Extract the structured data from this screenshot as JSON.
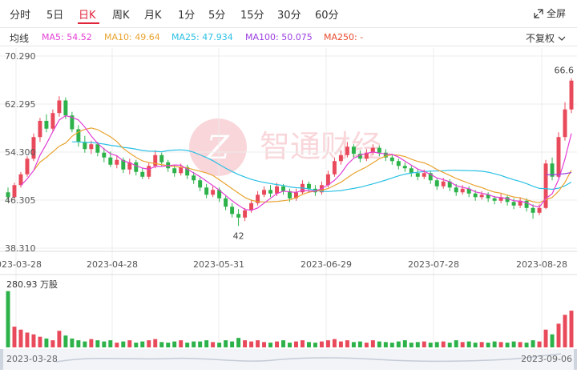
{
  "tabs": [
    {
      "label": "分时"
    },
    {
      "label": "5日"
    },
    {
      "label": "日K"
    },
    {
      "label": "周K"
    },
    {
      "label": "月K"
    },
    {
      "label": "1分"
    },
    {
      "label": "5分"
    },
    {
      "label": "15分"
    },
    {
      "label": "30分"
    },
    {
      "label": "60分"
    }
  ],
  "active_tab": "日K",
  "fullscreen_label": "全屏",
  "ma_legend": {
    "title": "均线",
    "ma5": "MA5: 54.52",
    "ma10": "MA10: 49.64",
    "ma25": "MA25: 47.934",
    "ma100": "MA100: 50.075",
    "ma250": "MA250: -"
  },
  "adjust_label": "不复权",
  "watermark_text": "智通财经",
  "volume_label": "280.93 万股",
  "navigator": {
    "start": "2023-03-28",
    "end": "2023-09-06"
  },
  "colors": {
    "up": "#e94a5b",
    "down": "#2db24a",
    "accent": "#e0243a",
    "ma5": "#e33fd5",
    "ma10": "#e9a330",
    "ma25": "#2bc0e4",
    "ma100": "#9b3fe0",
    "ma250": "#e84b2e"
  },
  "chart_data": {
    "type": "candlestick",
    "y_ticks": [
      "70.290",
      "62.295",
      "54.300",
      "46.305",
      "38.310"
    ],
    "ylim": [
      38.31,
      70.29
    ],
    "x_ticks": [
      "2023-03-28",
      "2023-04-28",
      "2023-05-31",
      "2023-06-29",
      "2023-07-28",
      "2023-08-28"
    ],
    "annotations": {
      "low": "42",
      "high": "66.6"
    },
    "candles": [
      [
        47.6,
        46.8,
        48.4,
        46.0
      ],
      [
        46.8,
        48.8,
        49.2,
        46.5
      ],
      [
        48.8,
        50.6,
        51.0,
        48.4
      ],
      [
        50.6,
        53.2,
        53.6,
        50.2
      ],
      [
        53.2,
        56.8,
        57.4,
        52.8
      ],
      [
        56.8,
        59.5,
        60.0,
        56.0
      ],
      [
        59.5,
        58.2,
        60.6,
        57.6
      ],
      [
        58.2,
        60.8,
        61.4,
        57.8
      ],
      [
        60.8,
        62.9,
        63.6,
        60.2
      ],
      [
        62.9,
        60.4,
        63.4,
        59.8
      ],
      [
        60.4,
        58.1,
        61.0,
        57.6
      ],
      [
        58.1,
        56.0,
        58.8,
        55.2
      ],
      [
        56.0,
        54.8,
        57.0,
        54.2
      ],
      [
        54.8,
        55.6,
        56.2,
        54.0
      ],
      [
        55.6,
        54.2,
        56.0,
        53.6
      ],
      [
        54.2,
        53.4,
        55.0,
        52.6
      ],
      [
        53.4,
        52.2,
        54.4,
        51.8
      ],
      [
        52.2,
        53.0,
        53.8,
        51.6
      ],
      [
        53.0,
        51.4,
        53.4,
        50.8
      ],
      [
        51.4,
        52.6,
        53.2,
        50.6
      ],
      [
        52.6,
        51.0,
        53.0,
        50.4
      ],
      [
        51.0,
        50.2,
        51.6,
        49.8
      ],
      [
        50.2,
        52.0,
        52.6,
        49.8
      ],
      [
        52.0,
        53.8,
        54.6,
        51.6
      ],
      [
        53.8,
        52.6,
        54.2,
        52.0
      ],
      [
        52.6,
        51.6,
        53.0,
        51.0
      ],
      [
        51.6,
        50.8,
        52.2,
        50.2
      ],
      [
        50.8,
        51.8,
        52.4,
        50.4
      ],
      [
        51.8,
        50.4,
        52.2,
        49.8
      ],
      [
        50.4,
        49.6,
        51.0,
        49.0
      ],
      [
        49.6,
        48.4,
        50.0,
        47.8
      ],
      [
        48.4,
        47.2,
        49.0,
        46.6
      ],
      [
        47.2,
        48.0,
        48.6,
        46.8
      ],
      [
        48.0,
        46.6,
        48.4,
        46.0
      ],
      [
        46.6,
        45.2,
        47.0,
        44.6
      ],
      [
        45.2,
        44.0,
        45.8,
        43.4
      ],
      [
        44.0,
        43.4,
        44.8,
        42.0
      ],
      [
        43.4,
        44.6,
        45.0,
        42.8
      ],
      [
        44.6,
        45.8,
        46.4,
        44.2
      ],
      [
        45.8,
        47.2,
        47.8,
        45.4
      ],
      [
        47.2,
        48.0,
        48.6,
        46.8
      ],
      [
        48.0,
        47.4,
        48.8,
        46.8
      ],
      [
        47.4,
        48.6,
        49.2,
        47.0
      ],
      [
        48.6,
        47.8,
        49.0,
        47.2
      ],
      [
        47.8,
        46.6,
        48.2,
        46.0
      ],
      [
        46.6,
        47.6,
        48.2,
        46.2
      ],
      [
        47.6,
        49.0,
        49.6,
        47.2
      ],
      [
        49.0,
        48.2,
        49.4,
        47.6
      ],
      [
        48.2,
        47.6,
        48.8,
        47.0
      ],
      [
        47.6,
        48.8,
        49.4,
        47.2
      ],
      [
        48.8,
        50.6,
        51.2,
        48.4
      ],
      [
        50.6,
        52.8,
        53.4,
        50.2
      ],
      [
        52.8,
        53.8,
        54.6,
        52.2
      ],
      [
        53.8,
        55.2,
        56.0,
        53.4
      ],
      [
        55.2,
        54.0,
        55.6,
        53.4
      ],
      [
        54.0,
        53.2,
        54.6,
        52.6
      ],
      [
        53.2,
        54.2,
        54.8,
        52.8
      ],
      [
        54.2,
        55.0,
        55.6,
        53.8
      ],
      [
        55.0,
        54.2,
        55.4,
        53.6
      ],
      [
        54.2,
        53.4,
        54.8,
        52.8
      ],
      [
        53.4,
        52.8,
        54.0,
        52.2
      ],
      [
        52.8,
        52.0,
        53.2,
        51.4
      ],
      [
        52.0,
        51.6,
        52.6,
        51.0
      ],
      [
        51.6,
        50.8,
        52.0,
        50.2
      ],
      [
        50.8,
        50.2,
        51.4,
        49.6
      ],
      [
        50.2,
        50.8,
        51.4,
        49.8
      ],
      [
        50.8,
        49.6,
        51.2,
        49.0
      ],
      [
        49.6,
        48.6,
        50.0,
        48.0
      ],
      [
        48.6,
        49.4,
        50.0,
        48.2
      ],
      [
        49.4,
        48.4,
        49.8,
        47.8
      ],
      [
        48.4,
        47.6,
        49.0,
        47.0
      ],
      [
        47.6,
        48.2,
        48.8,
        47.2
      ],
      [
        48.2,
        47.4,
        48.6,
        46.8
      ],
      [
        47.4,
        46.8,
        48.0,
        46.2
      ],
      [
        46.8,
        47.2,
        47.8,
        46.4
      ],
      [
        47.2,
        46.6,
        47.6,
        46.0
      ],
      [
        46.6,
        46.2,
        47.0,
        45.6
      ],
      [
        46.2,
        46.8,
        47.4,
        45.8
      ],
      [
        46.8,
        46.0,
        47.2,
        45.4
      ],
      [
        46.0,
        45.4,
        46.6,
        44.8
      ],
      [
        45.4,
        46.2,
        46.8,
        45.0
      ],
      [
        46.2,
        45.0,
        46.6,
        44.4
      ],
      [
        45.0,
        44.2,
        45.6,
        43.2
      ],
      [
        44.2,
        45.0,
        45.6,
        43.8
      ],
      [
        45.0,
        52.4,
        53.0,
        44.8
      ],
      [
        52.4,
        50.2,
        53.4,
        49.6
      ],
      [
        50.2,
        56.8,
        57.6,
        50.0
      ],
      [
        56.8,
        61.4,
        62.6,
        56.2
      ],
      [
        61.4,
        66.2,
        66.6,
        60.8
      ]
    ],
    "volume": [
      0.95,
      0.35,
      0.3,
      0.25,
      0.22,
      0.18,
      0.15,
      0.12,
      0.28,
      0.2,
      0.15,
      0.12,
      0.1,
      0.14,
      0.12,
      0.1,
      0.12,
      0.08,
      0.1,
      0.12,
      0.08,
      0.1,
      0.12,
      0.14,
      0.09,
      0.08,
      0.1,
      0.12,
      0.08,
      0.1,
      0.1,
      0.12,
      0.09,
      0.08,
      0.12,
      0.1,
      0.16,
      0.12,
      0.1,
      0.12,
      0.09,
      0.08,
      0.1,
      0.12,
      0.08,
      0.1,
      0.12,
      0.09,
      0.08,
      0.1,
      0.12,
      0.14,
      0.1,
      0.12,
      0.09,
      0.1,
      0.08,
      0.12,
      0.1,
      0.09,
      0.08,
      0.1,
      0.12,
      0.08,
      0.09,
      0.1,
      0.08,
      0.09,
      0.1,
      0.08,
      0.12,
      0.09,
      0.1,
      0.08,
      0.09,
      0.08,
      0.1,
      0.09,
      0.08,
      0.1,
      0.09,
      0.08,
      0.12,
      0.1,
      0.3,
      0.22,
      0.4,
      0.55,
      0.62
    ]
  }
}
